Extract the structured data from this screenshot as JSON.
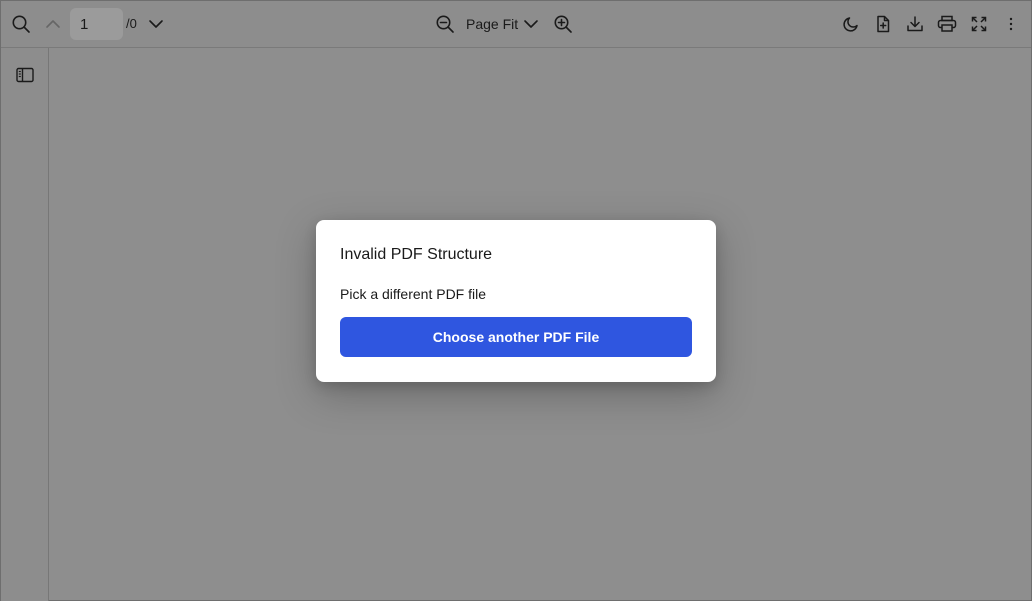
{
  "toolbar": {
    "current_page": "1",
    "page_total": "/0",
    "zoom_label": "Page Fit",
    "icons": {
      "search": "search-icon",
      "prev_page": "chevron-up-icon",
      "next_page": "chevron-down-icon",
      "zoom_out": "zoom-out-icon",
      "zoom_dropdown": "chevron-down-icon",
      "zoom_in": "zoom-in-icon",
      "dark_mode": "moon-icon",
      "open_file": "file-plus-icon",
      "download": "download-icon",
      "print": "printer-icon",
      "fullscreen": "fullscreen-icon",
      "more": "more-vertical-icon"
    }
  },
  "sidebar": {
    "toggle_icon": "sidebar-toggle-icon"
  },
  "dialog": {
    "title": "Invalid PDF Structure",
    "message": "Pick a different PDF file",
    "button_label": "Choose another PDF File",
    "button_color": "#2f56e0"
  }
}
